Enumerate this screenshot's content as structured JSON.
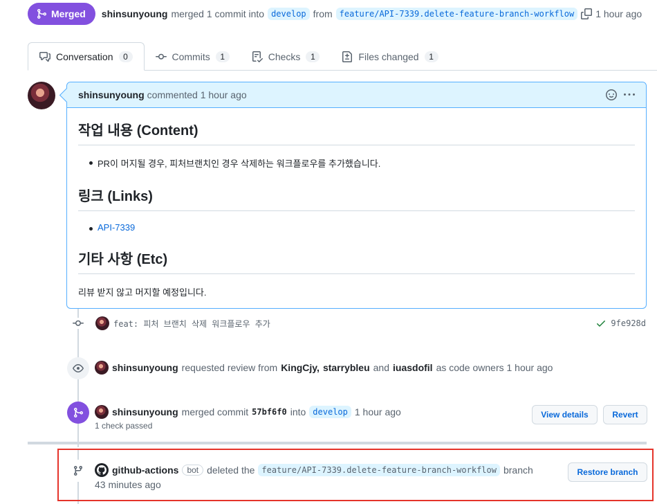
{
  "header": {
    "status_label": "Merged",
    "author": "shinsunyoung",
    "action_text": "merged 1 commit into",
    "base_branch": "develop",
    "from_text": "from",
    "head_branch": "feature/API-7339.delete-feature-branch-workflow",
    "time": "1 hour ago"
  },
  "tabs": [
    {
      "label": "Conversation",
      "count": "0"
    },
    {
      "label": "Commits",
      "count": "1"
    },
    {
      "label": "Checks",
      "count": "1"
    },
    {
      "label": "Files changed",
      "count": "1"
    }
  ],
  "comment": {
    "author": "shinsunyoung",
    "meta": "commented 1 hour ago",
    "sections": [
      {
        "heading": "작업 내용 (Content)",
        "item": "PR이 머지될 경우, 피처브랜치인 경우 삭제하는 워크플로우를 추가했습니다."
      },
      {
        "heading": "링크 (Links)",
        "item": "API-7339"
      },
      {
        "heading": "기타 사항 (Etc)",
        "text": "리뷰 받지 않고 머지할 예정입니다."
      }
    ]
  },
  "commit": {
    "message": "feat: 피처 브랜치 삭제 워크플로우 추가",
    "sha": "9fe928d"
  },
  "review_event": {
    "author": "shinsunyoung",
    "text1": "requested review from",
    "reviewer1": "KingCjy,",
    "reviewer2": "starrybleu",
    "and_text": "and",
    "reviewer3": "iuasdofil",
    "text2": "as code owners 1 hour ago"
  },
  "merge_event": {
    "author": "shinsunyoung",
    "text1": "merged commit",
    "sha": "57bf6f0",
    "into_text": "into",
    "branch": "develop",
    "time": "1 hour ago",
    "checks": "1 check passed",
    "view_details": "View details",
    "revert": "Revert"
  },
  "delete_event": {
    "author": "github-actions",
    "bot": "bot",
    "text1": "deleted the",
    "branch": "feature/API-7339.delete-feature-branch-workflow",
    "text2": "branch",
    "time": "43 minutes ago",
    "restore": "Restore branch"
  },
  "colors": {
    "merged": "#8250df",
    "link": "#0969da",
    "highlight": "#e5332a",
    "success": "#1a7f37"
  }
}
